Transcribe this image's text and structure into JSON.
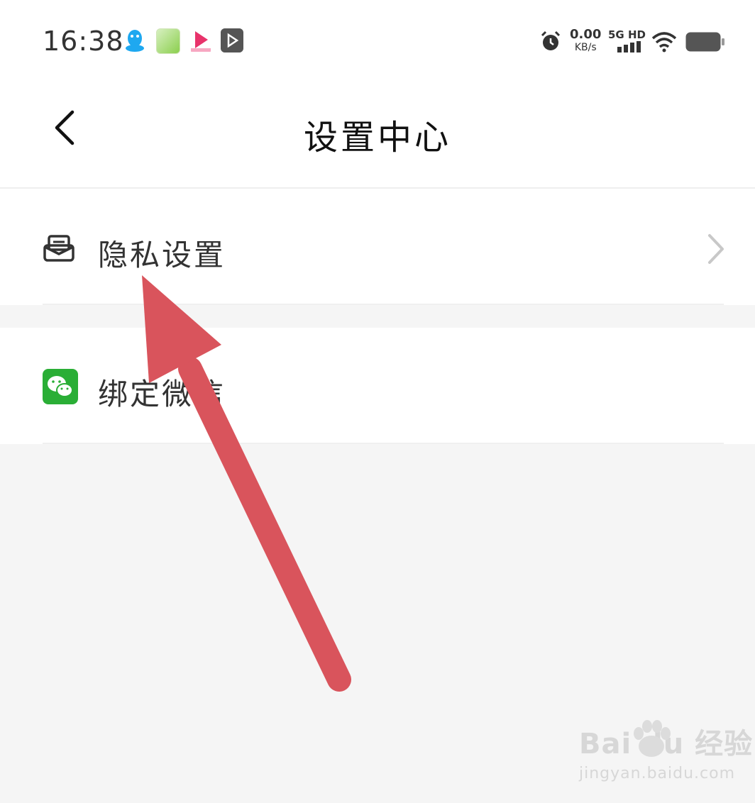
{
  "status_bar": {
    "time": "16:38",
    "net_speed_value": "0.00",
    "net_speed_unit": "KB/s",
    "network_type": "5G HD",
    "icons": [
      "qq-icon",
      "photo-app-icon",
      "video-app-icon",
      "player-app-icon",
      "alarm-icon",
      "signal-icon",
      "wifi-icon",
      "battery-icon"
    ]
  },
  "header": {
    "title": "设置中心",
    "back_icon": "chevron-left-icon"
  },
  "settings": {
    "items": [
      {
        "label": "隐私设置",
        "icon": "mail-icon",
        "has_chevron": true
      },
      {
        "label": "绑定微信",
        "icon": "wechat-icon",
        "has_chevron": false
      }
    ]
  },
  "annotation": {
    "arrow_color": "#d9545c"
  },
  "watermark": {
    "logo_text": "Bai du 经验",
    "url": "jingyan.baidu.com"
  },
  "colors": {
    "background": "#f5f5f5",
    "surface": "#ffffff",
    "wechat_green": "#2aae36"
  }
}
